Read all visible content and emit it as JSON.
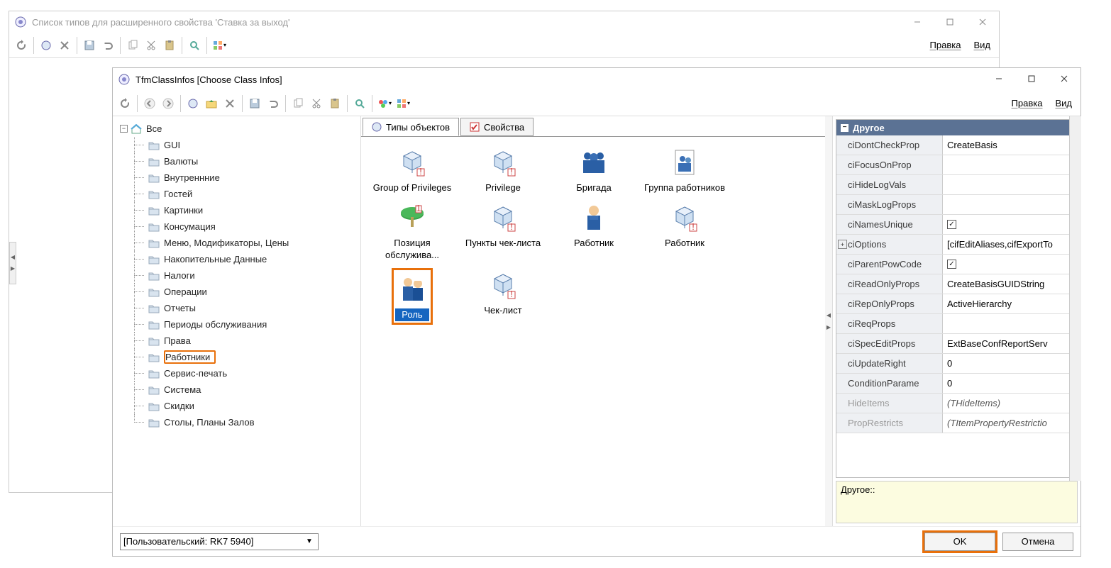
{
  "parent": {
    "title": "Список типов для расширенного свойства 'Ставка за выход'",
    "menu": {
      "edit": "Правка",
      "view": "Вид"
    }
  },
  "dialog": {
    "title": "TfmClassInfos [Choose Class Infos]",
    "menu": {
      "edit": "Правка",
      "view": "Вид"
    },
    "tabs": {
      "types": "Типы объектов",
      "props": "Свойства"
    },
    "tree_root": "Все",
    "tree_items": [
      "GUI",
      "Валюты",
      "Внутреннние",
      "Гостей",
      "Картинки",
      "Консумация",
      "Меню, Модификаторы, Цены",
      "Накопительные Данные",
      "Налоги",
      "Операции",
      "Отчеты",
      "Периоды обслуживания",
      "Права",
      "Работники",
      "Сервис-печать",
      "Система",
      "Скидки",
      "Столы, Планы Залов"
    ],
    "tree_selected": "Работники",
    "objects": [
      {
        "label": "Group of Privileges",
        "icon": "cube"
      },
      {
        "label": "Privilege",
        "icon": "cube"
      },
      {
        "label": "Бригада",
        "icon": "team-blue"
      },
      {
        "label": "Группа работников",
        "icon": "file-people"
      },
      {
        "label": "Позиция обслужива...",
        "icon": "table-round"
      },
      {
        "label": "Пункты чек-листа",
        "icon": "cube"
      },
      {
        "label": "Работник",
        "icon": "person-blue"
      },
      {
        "label": "Работник",
        "icon": "cube"
      },
      {
        "label": "Роль",
        "icon": "two-people",
        "selected": true
      },
      {
        "label": "Чек-лист",
        "icon": "cube"
      }
    ],
    "prop_header": "Другое",
    "props": [
      {
        "name": "ciDontCheckProp",
        "value": "CreateBasis"
      },
      {
        "name": "ciFocusOnProp",
        "value": ""
      },
      {
        "name": "ciHideLogVals",
        "value": ""
      },
      {
        "name": "ciMaskLogProps",
        "value": ""
      },
      {
        "name": "ciNamesUnique",
        "value": "",
        "checkbox": true,
        "checked": true
      },
      {
        "name": "ciOptions",
        "value": "[cifEditAliases,cifExportTo",
        "expandable": true
      },
      {
        "name": "ciParentPowCode",
        "value": "",
        "checkbox": true,
        "checked": true
      },
      {
        "name": "ciReadOnlyProps",
        "value": "CreateBasisGUIDString"
      },
      {
        "name": "ciRepOnlyProps",
        "value": "ActiveHierarchy"
      },
      {
        "name": "ciReqProps",
        "value": ""
      },
      {
        "name": "ciSpecEditProps",
        "value": "ExtBaseConfReportServ"
      },
      {
        "name": "ciUpdateRight",
        "value": "0"
      },
      {
        "name": "ConditionParame",
        "value": "0"
      },
      {
        "name": "HideItems",
        "value": "(THideItems)",
        "dim": true,
        "italic": true
      },
      {
        "name": "PropRestricts",
        "value": "(TItemPropertyRestrictio",
        "dim": true,
        "italic": true
      }
    ],
    "desc": "Другое::",
    "combo": "[Пользовательский: RK7 5940]",
    "ok": "OK",
    "cancel": "Отмена"
  }
}
